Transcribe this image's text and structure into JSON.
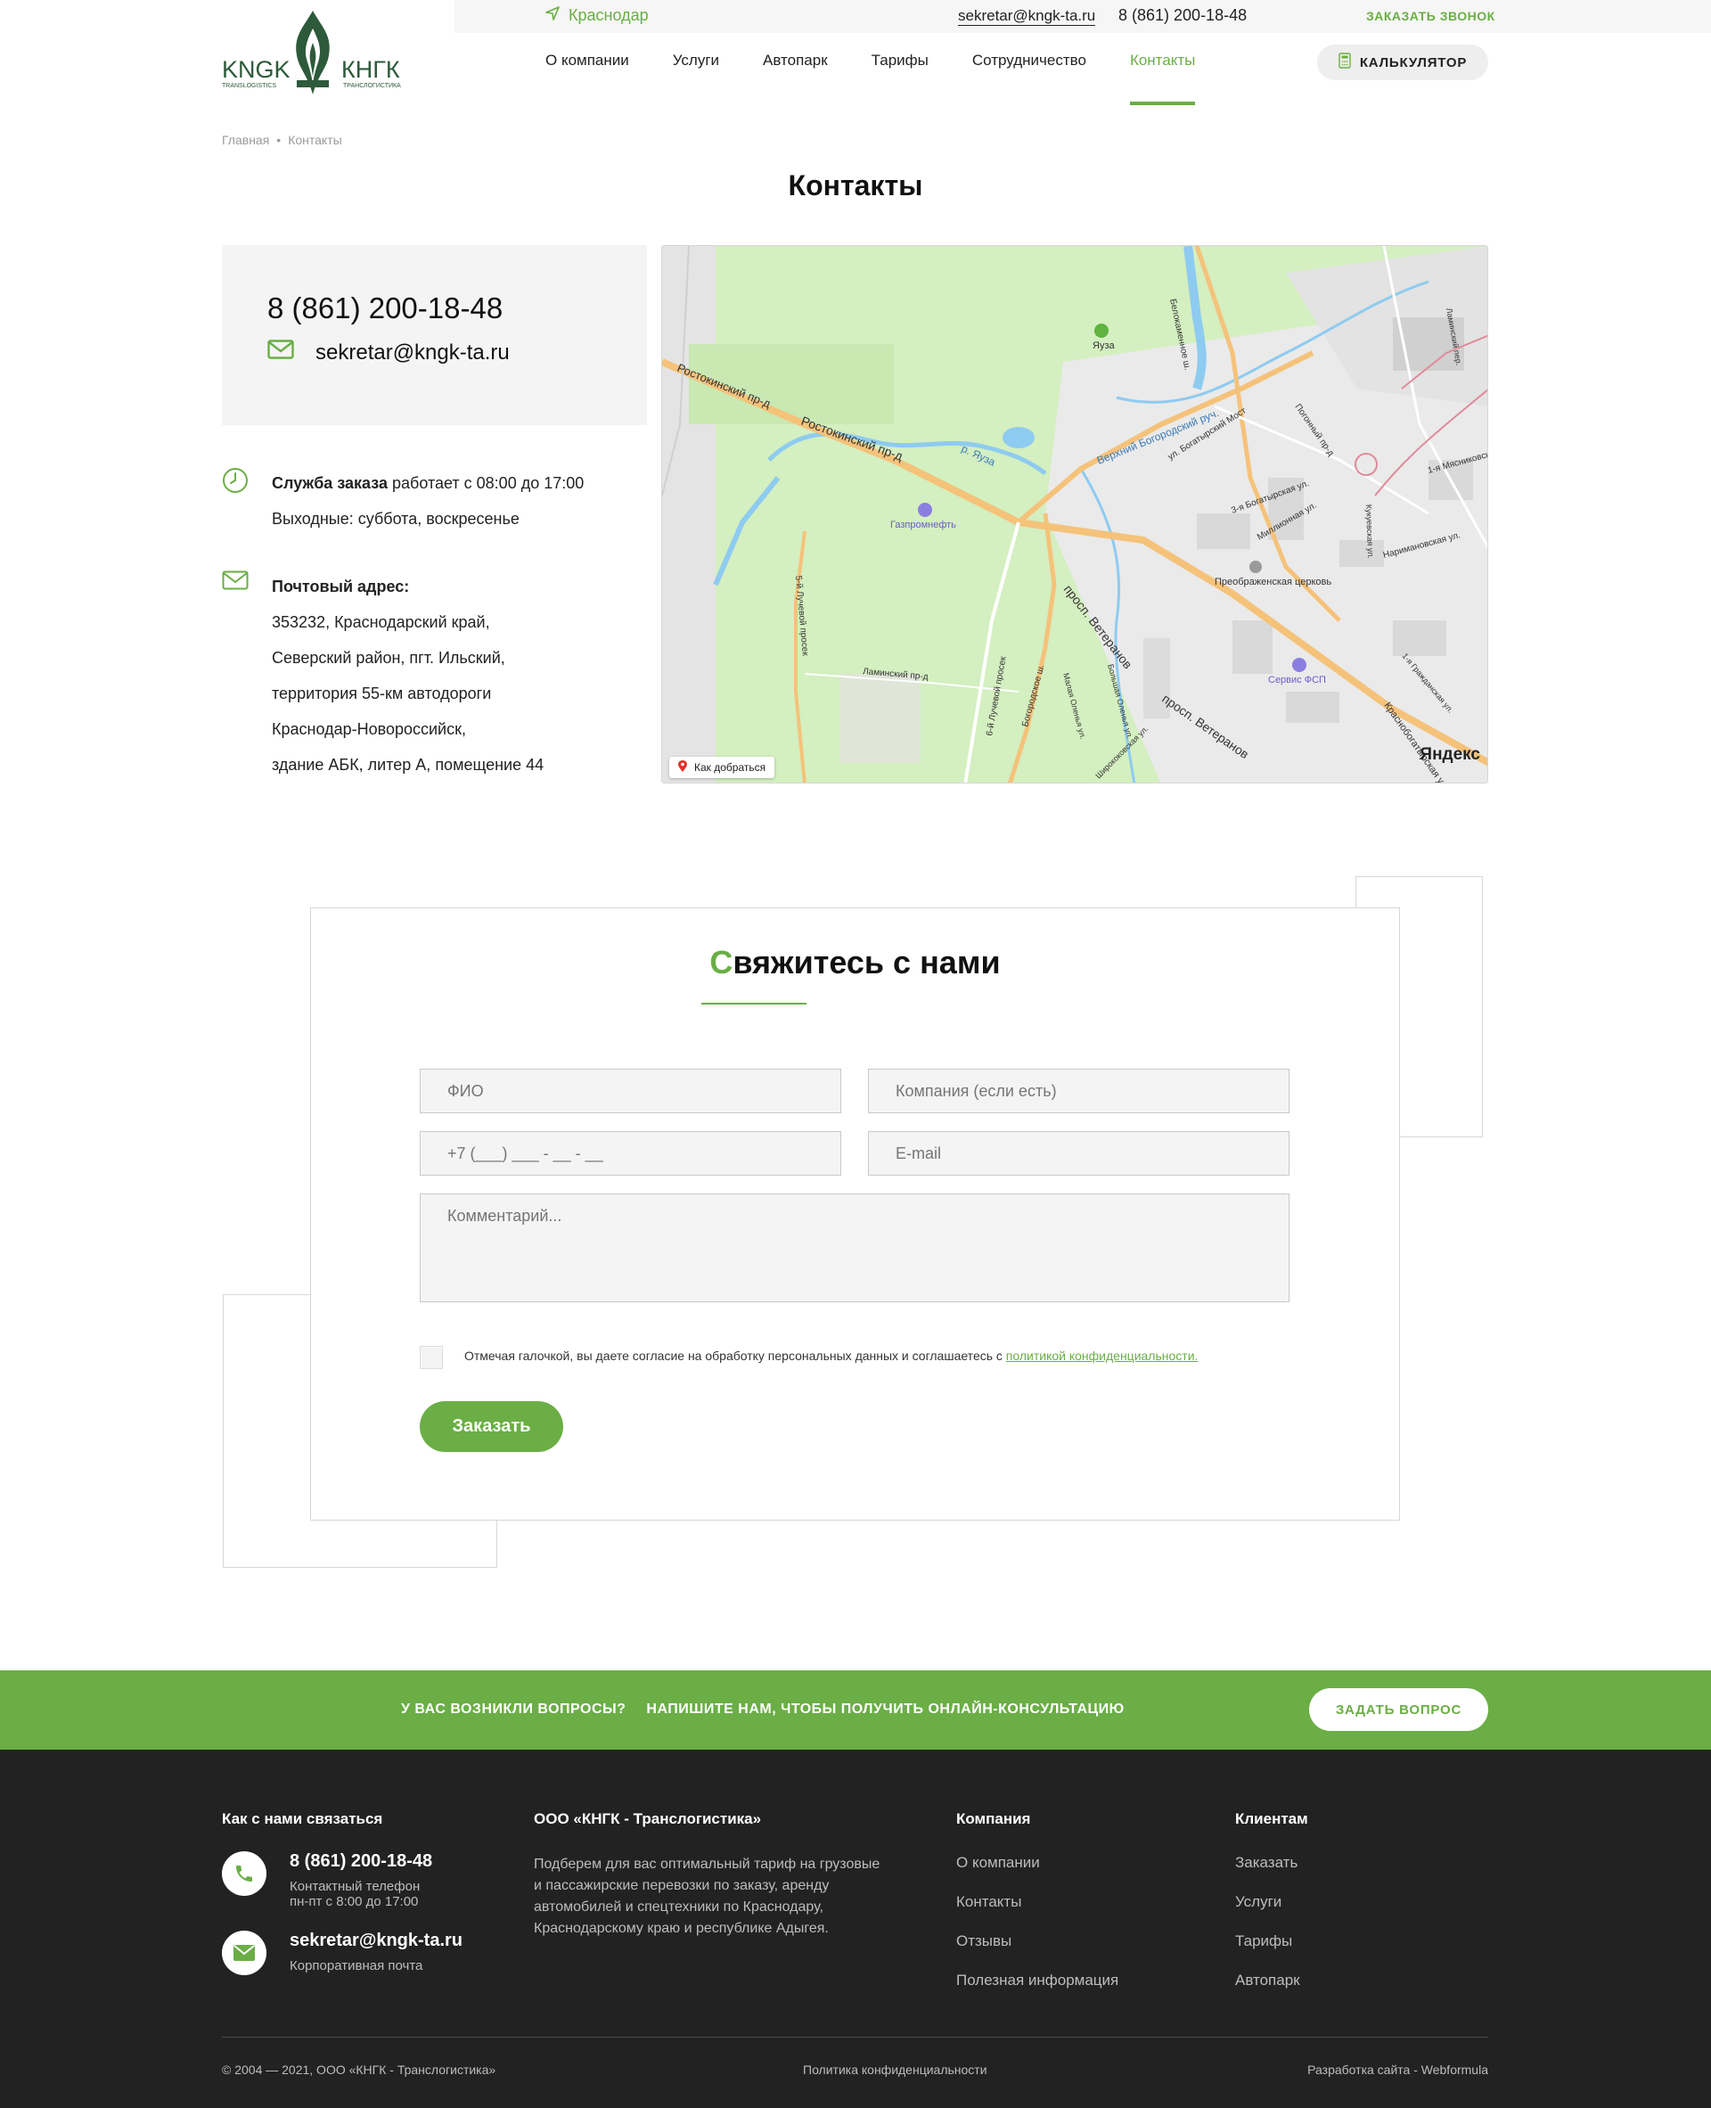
{
  "header": {
    "city": "Краснодар",
    "email": "sekretar@kngk-ta.ru",
    "phone": "8 (861) 200-18-48",
    "callback": "ЗАКАЗАТЬ ЗВОНОК",
    "logo_left": "KNGK",
    "logo_right": "КНГК",
    "logo_sub_left": "TRANSLOGISTICS",
    "logo_sub_right": "ТРАНСЛОГИСТИКА",
    "nav": [
      "О компании",
      "Услуги",
      "Автопарк",
      "Тарифы",
      "Сотрудничество",
      "Контакты"
    ],
    "active_nav": "Контакты",
    "calculator": "КАЛЬКУЛЯТОР"
  },
  "breadcrumb": [
    "Главная",
    "Контакты"
  ],
  "breadcrumb_sep": "•",
  "page_title": "Контакты",
  "contacts": {
    "phone": "8 (861) 200-18-48",
    "email": "sekretar@kngk-ta.ru",
    "service_label": "Служба заказа",
    "service_hours": " работает с 08:00 до 17:00",
    "days_off": "Выходные: суббота, воскресенье",
    "address_label": "Почтовый адрес:",
    "address_lines": [
      "353232, Краснодарский край,",
      "Северский район, пгт. Ильский,",
      "территория 55-км автодороги",
      "Краснодар-Новороссийск,",
      "здание АБК, литер А, помещение 44"
    ]
  },
  "map": {
    "labels": [
      "Ростокинский пр-д",
      "Ростокинский пр-д",
      "р. Яуза",
      "Яуза",
      "Газпромнефть",
      "Верхний Богородский руч.",
      "ул. Богатырский Мост",
      "3-я Богатырская ул.",
      "Миллионная ул.",
      "Преображенская церковь",
      "просп. Ветеранов",
      "просп. Ветеранов",
      "Сервис ФСП",
      "Богородское ш.",
      "5-й Лучевой просек",
      "6-й Лучевой просек",
      "Ламинский пр-д",
      "Погонный пр-д",
      "Наримановская ул.",
      "1-я Мясниковская",
      "Краснобогатырская ул.",
      "Белокаменное ш.",
      "Малая Оленья ул.",
      "Большая Оленья ул.",
      "Ширококовская ул.",
      "1-я Гражданская ул.",
      "Ламинский пер.",
      "Кукуевская ул."
    ],
    "route": "Как добраться",
    "brand": "Яндекс",
    "colors": {
      "park": "#d4efc0",
      "road": "#f5c27a",
      "water": "#8ecbf0",
      "block": "#e6e6e6"
    }
  },
  "form": {
    "title_first": "С",
    "title_rest": "вяжитесь с нами",
    "fio": "ФИО",
    "company": "Компания (если есть)",
    "phone": "+7 (___) ___ - __ - __",
    "email": "E-mail",
    "comment": "Комментарий...",
    "consent": "Отмечая галочкой, вы даете согласие на обработку персональных данных и соглашаетесь с ",
    "consent_link": "политикой конфиденциальности.",
    "submit": "Заказать"
  },
  "cta": {
    "question": "У ВАС ВОЗНИКЛИ ВОПРОСЫ?",
    "text": "НАПИШИТЕ НАМ, ЧТОБЫ ПОЛУЧИТЬ ОНЛАЙН-КОНСУЛЬТАЦИЮ",
    "button": "ЗАДАТЬ ВОПРОС"
  },
  "footer": {
    "contact_head": "Как с нами связаться",
    "phone": "8 (861) 200-18-48",
    "phone_sub1": "Контактный телефон",
    "phone_sub2": "пн-пт с 8:00 до 17:00",
    "email": "sekretar@kngk-ta.ru",
    "email_sub": "Корпоративная почта",
    "company_head": "ООО «КНГК - Транслогистика»",
    "about": "Подберем для вас оптимальный тариф на грузовые и пассажирские перевозки по заказу, аренду автомобилей и спецтехники по Краснодару, Краснодарскому краю и республике Адыгея.",
    "col3_head": "Компания",
    "col3_links": [
      "О компании",
      "Контакты",
      "Отзывы",
      "Полезная информация"
    ],
    "col4_head": "Клиентам",
    "col4_links": [
      "Заказать",
      "Услуги",
      "Тарифы",
      "Автопарк"
    ],
    "copyright": "© 2004 — 2021, ООО «КНГК - Транслогистика»",
    "policy": "Политика конфиденциальности",
    "dev": "Разработка сайта - Webformula"
  },
  "colors": {
    "accent": "#6aae45",
    "logo": "#2d5a3a",
    "footer_bg": "#222222",
    "card_bg": "#f4f4f4"
  }
}
